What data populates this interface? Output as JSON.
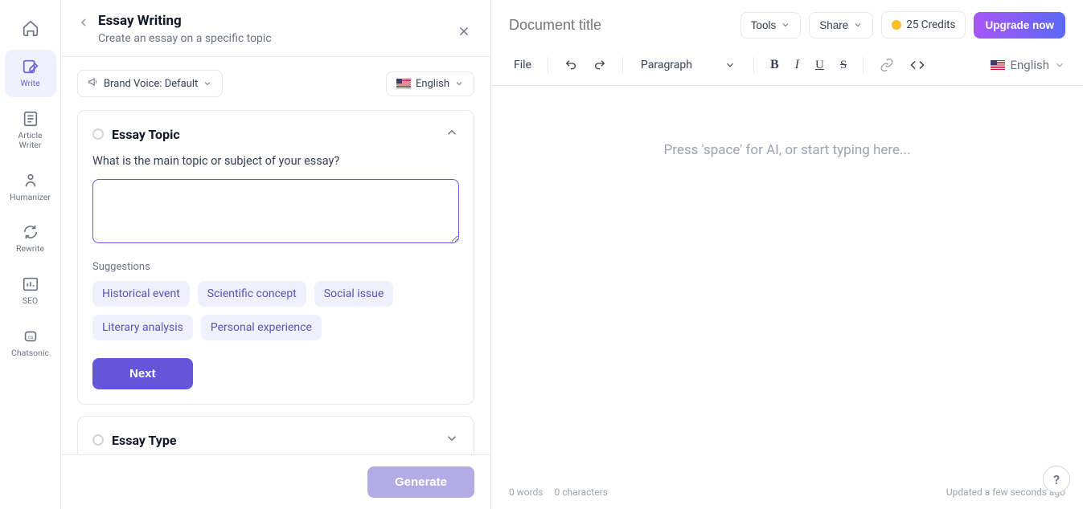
{
  "sidebar": {
    "items": [
      {
        "label": "",
        "name": "home"
      },
      {
        "label": "Write",
        "name": "write"
      },
      {
        "label": "Article Writer",
        "name": "article-writer"
      },
      {
        "label": "Humanizer",
        "name": "humanizer"
      },
      {
        "label": "Rewrite",
        "name": "rewrite"
      },
      {
        "label": "SEO",
        "name": "seo"
      },
      {
        "label": "Chatsonic",
        "name": "chatsonic"
      }
    ]
  },
  "panel": {
    "title": "Essay Writing",
    "subtitle": "Create an essay on a specific topic",
    "brand_voice_label": "Brand Voice: Default",
    "language": "English",
    "step1": {
      "title": "Essay Topic",
      "question": "What is the main topic or subject of your essay?",
      "textarea_value": "",
      "suggestions_label": "Suggestions",
      "suggestions": [
        "Historical event",
        "Scientific concept",
        "Social issue",
        "Literary analysis",
        "Personal experience"
      ],
      "next_label": "Next"
    },
    "step2": {
      "title": "Essay Type"
    },
    "generate_label": "Generate"
  },
  "editor": {
    "doc_title_placeholder": "Document title",
    "tools_label": "Tools",
    "share_label": "Share",
    "credits_label": "25 Credits",
    "upgrade_label": "Upgrade now",
    "file_label": "File",
    "paragraph_label": "Paragraph",
    "language_label": "English",
    "placeholder": "Press 'space' for AI, or start typing here...",
    "word_count": "0 words",
    "char_count": "0 characters",
    "updated": "Updated a few seconds ago"
  }
}
